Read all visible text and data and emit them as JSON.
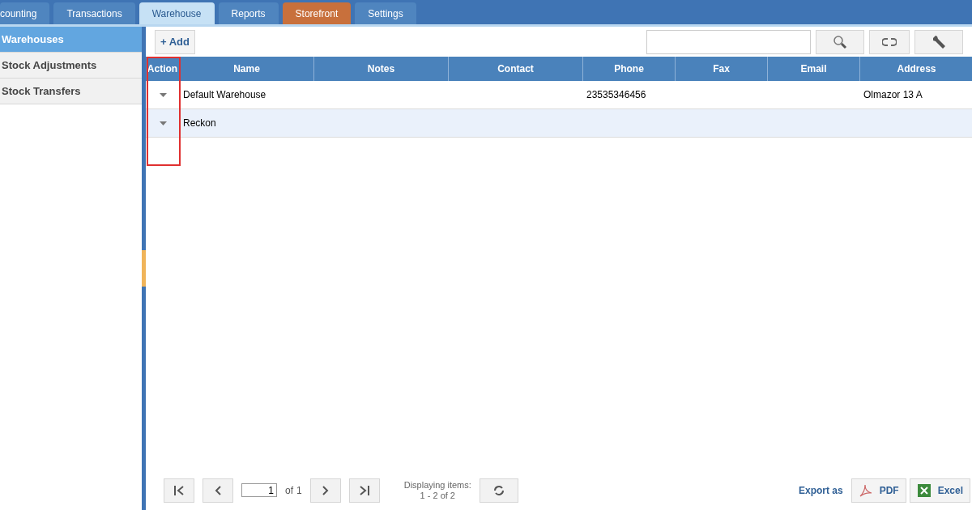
{
  "tabs": [
    {
      "label": "counting",
      "selected": false,
      "kind": "standard"
    },
    {
      "label": "Transactions",
      "selected": false,
      "kind": "standard"
    },
    {
      "label": "Warehouse",
      "selected": true,
      "kind": "standard"
    },
    {
      "label": "Reports",
      "selected": false,
      "kind": "standard"
    },
    {
      "label": "Storefront",
      "selected": false,
      "kind": "store"
    },
    {
      "label": "Settings",
      "selected": false,
      "kind": "standard"
    }
  ],
  "sidebar": {
    "items": [
      {
        "label": "Warehouses",
        "selected": true
      },
      {
        "label": "Stock Adjustments",
        "selected": false
      },
      {
        "label": "Stock Transfers",
        "selected": false
      }
    ]
  },
  "toolbar": {
    "add_button": "+ Add"
  },
  "table": {
    "columns": [
      {
        "label": "Action",
        "highlighted": true
      },
      {
        "label": "Name",
        "highlighted": false
      },
      {
        "label": "Notes",
        "highlighted": false
      },
      {
        "label": "Contact",
        "highlighted": false
      },
      {
        "label": "Phone",
        "highlighted": false
      },
      {
        "label": "Fax",
        "highlighted": false
      },
      {
        "label": "Email",
        "highlighted": false
      },
      {
        "label": "Address",
        "highlighted": false
      }
    ],
    "rows": [
      {
        "selected": false,
        "cells": [
          "",
          "Default Warehouse",
          "",
          "",
          "23535346456",
          "",
          "",
          "Olmazor 13 A"
        ]
      },
      {
        "selected": true,
        "cells": [
          "",
          "Reckon",
          "",
          "",
          "",
          "",
          "",
          ""
        ]
      }
    ]
  },
  "pager": {
    "page": "1",
    "of": "of",
    "total": "1",
    "display_line1": "Displaying items:",
    "display_line2": "1 - 2 of 2"
  },
  "export": {
    "label": "Export as",
    "buttons": [
      {
        "kind": "pdf",
        "label": "PDF"
      },
      {
        "kind": "excel",
        "label": "Excel"
      }
    ]
  }
}
